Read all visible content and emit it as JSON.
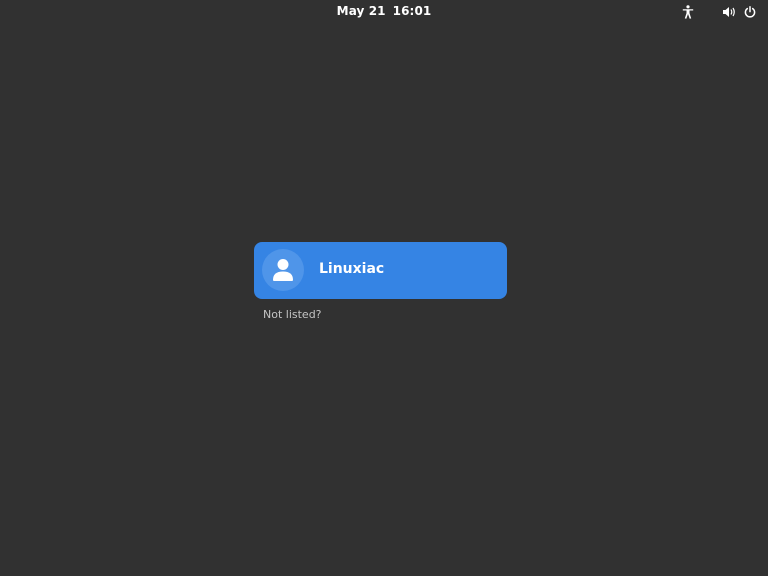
{
  "topbar": {
    "date": "May 21",
    "time": "16:01",
    "icons": {
      "accessibility": "accessibility-icon",
      "volume": "volume-icon",
      "power": "power-icon"
    }
  },
  "login": {
    "users": [
      {
        "name": "Linuxiac",
        "avatar_icon": "user-icon"
      }
    ],
    "not_listed_label": "Not listed?"
  },
  "colors": {
    "background": "#313131",
    "accent": "#3584e4",
    "avatar_bg": "#4f95e9",
    "text": "#ffffff",
    "muted_text": "#c4c4c4"
  }
}
